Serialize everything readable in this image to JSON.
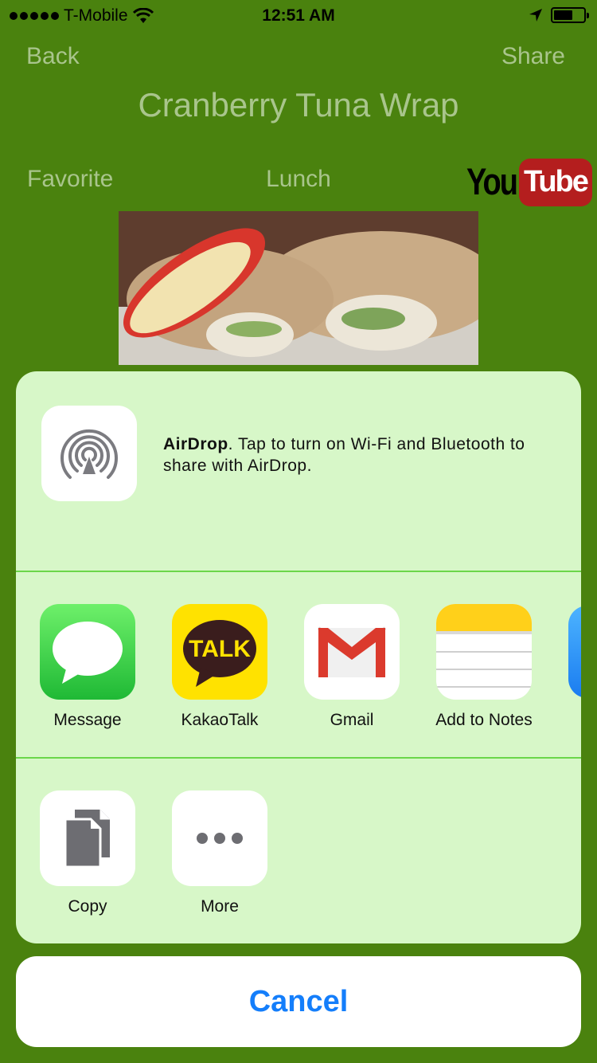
{
  "status_bar": {
    "carrier": "T-Mobile",
    "time": "12:51 AM",
    "battery_level": 0.65
  },
  "nav": {
    "back_label": "Back",
    "share_label": "Share",
    "title": "Cranberry Tuna Wrap"
  },
  "recipe": {
    "favorite_label": "Favorite",
    "category": "Lunch",
    "youtube_you": "You",
    "youtube_tube": "Tube"
  },
  "share_sheet": {
    "airdrop": {
      "title": "AirDrop",
      "message": ". Tap to turn on Wi-Fi and Bluetooth to share with AirDrop."
    },
    "apps": [
      {
        "label": "Message",
        "icon": "messages-icon"
      },
      {
        "label": "KakaoTalk",
        "icon": "kakaotalk-icon",
        "icon_text": "TALK"
      },
      {
        "label": "Gmail",
        "icon": "gmail-icon"
      },
      {
        "label": "Add to Notes",
        "icon": "notes-icon"
      }
    ],
    "actions": [
      {
        "label": "Copy",
        "icon": "copy-icon"
      },
      {
        "label": "More",
        "icon": "more-icon"
      }
    ],
    "cancel_label": "Cancel"
  },
  "colors": {
    "background": "#4a820e",
    "sheet": "#d7f7c8",
    "accent": "#147efb",
    "divider": "#6bd64a"
  }
}
